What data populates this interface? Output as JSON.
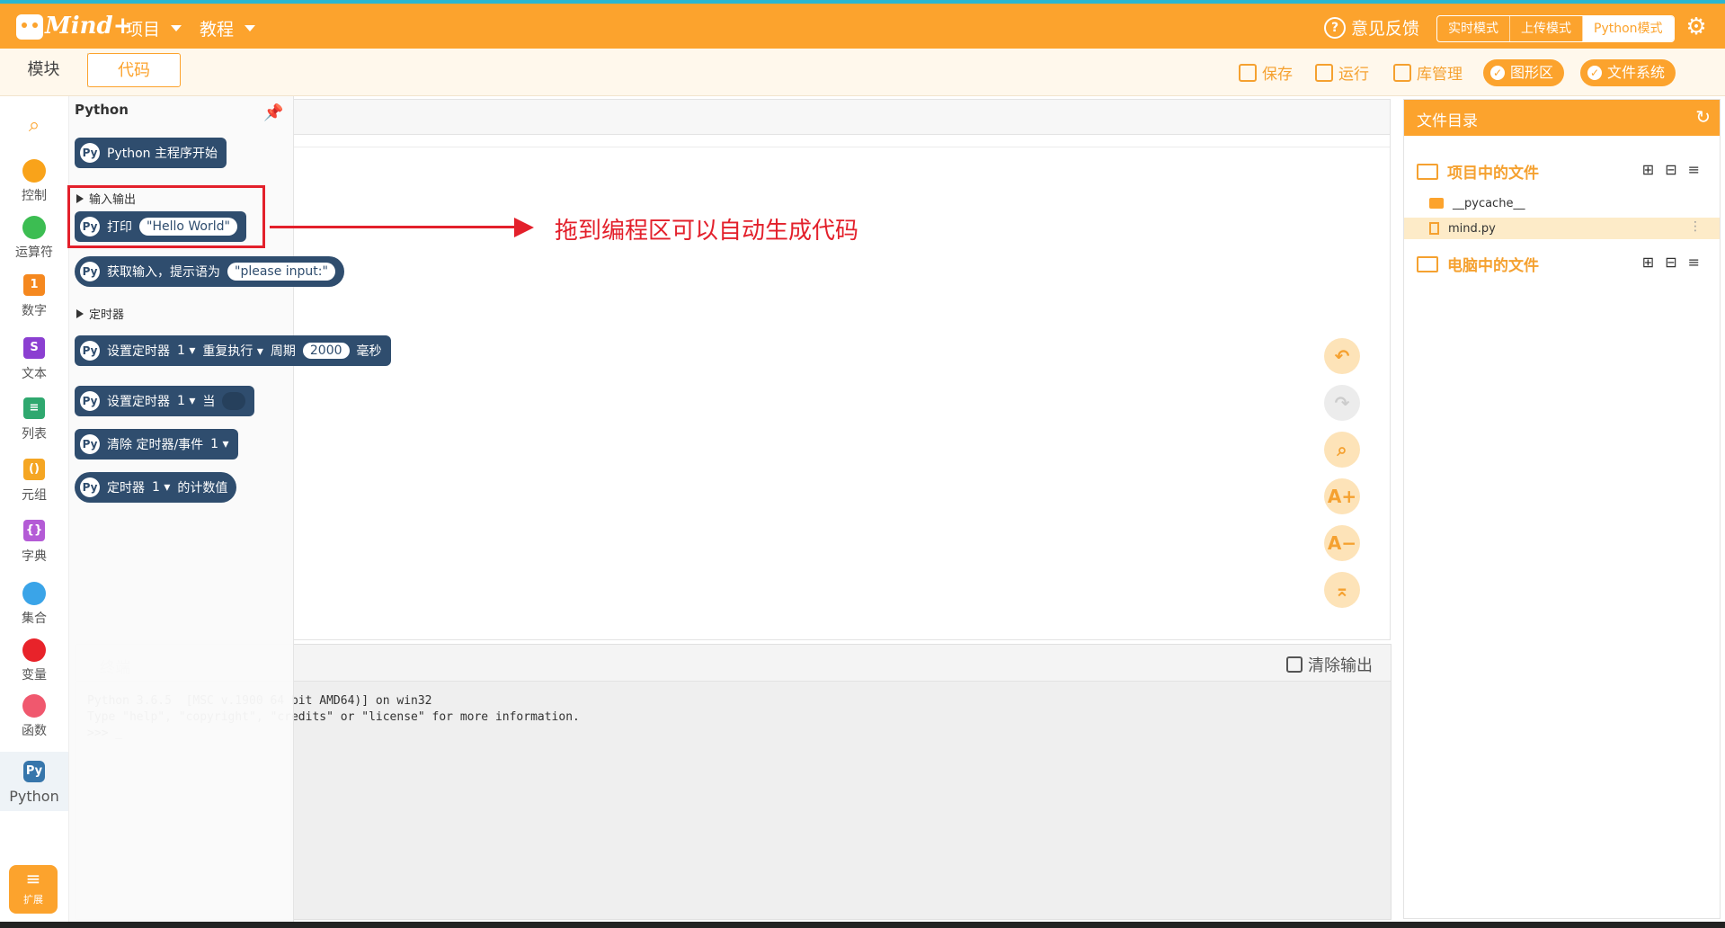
{
  "menubar": {
    "logo": "Mind+",
    "menu_project": "项目",
    "menu_tutorial": "教程",
    "feedback": "意见反馈",
    "modes": [
      "实时模式",
      "上传模式",
      "Python模式"
    ],
    "active_mode": "Python模式"
  },
  "toolbar": {
    "tab_blocks": "模块",
    "tab_code": "代码",
    "save": "保存",
    "run": "运行",
    "libs": "库管理",
    "graphic_area": "图形区",
    "file_system": "文件系统"
  },
  "categories": [
    {
      "label": "控制",
      "color": "#f9a31a"
    },
    {
      "label": "运算符",
      "color": "#3cbd52"
    },
    {
      "label": "数字",
      "color": "#f5881f",
      "glyph": "1"
    },
    {
      "label": "文本",
      "color": "#8b3fd1",
      "glyph": "S"
    },
    {
      "label": "列表",
      "color": "#2fa86f",
      "glyph": "≡"
    },
    {
      "label": "元组",
      "color": "#f5a623",
      "glyph": "()"
    },
    {
      "label": "字典",
      "color": "#b45bd6",
      "glyph": "{}"
    },
    {
      "label": "集合",
      "color": "#3aa4e8"
    },
    {
      "label": "变量",
      "color": "#e8232a"
    },
    {
      "label": "函数",
      "color": "#f0586e"
    },
    {
      "label": "Python",
      "color": "#3776ab"
    }
  ],
  "extension_label": "扩展",
  "flyout": {
    "title": "Python",
    "block_main": "Python 主程序开始",
    "section_io": "输入输出",
    "block_print": "打印",
    "print_value": "\"Hello World\"",
    "block_input": "获取输入，提示语为",
    "input_value": "\"please input:\"",
    "section_timer": "定时器",
    "timer1_label": "设置定时器",
    "timer1_num": "1",
    "timer1_mode": "重复执行",
    "timer1_period": "周期",
    "timer1_value": "2000",
    "timer1_unit": "毫秒",
    "timer2_label": "设置定时器",
    "timer2_num": "1",
    "timer2_when": "当",
    "timer3_label": "清除 定时器/事件",
    "timer3_num": "1",
    "timer4_label": "定时器",
    "timer4_num": "1",
    "timer4_suffix": "的计数值"
  },
  "annotation": "拖到编程区可以自动生成代码",
  "terminal": {
    "title": "终端",
    "clear": "清除输出",
    "lines": [
      "Python 3.6.5  [MSC v.1900 64 bit AMD64)] on win32",
      "Type \"help\", \"copyright\", \"credits\" or \"license\" for more information.",
      ">>> _"
    ]
  },
  "files": {
    "title": "文件目录",
    "project_files": "项目中的文件",
    "pycache": "__pycache__",
    "mind_py": "mind.py",
    "computer_files": "电脑中的文件"
  }
}
